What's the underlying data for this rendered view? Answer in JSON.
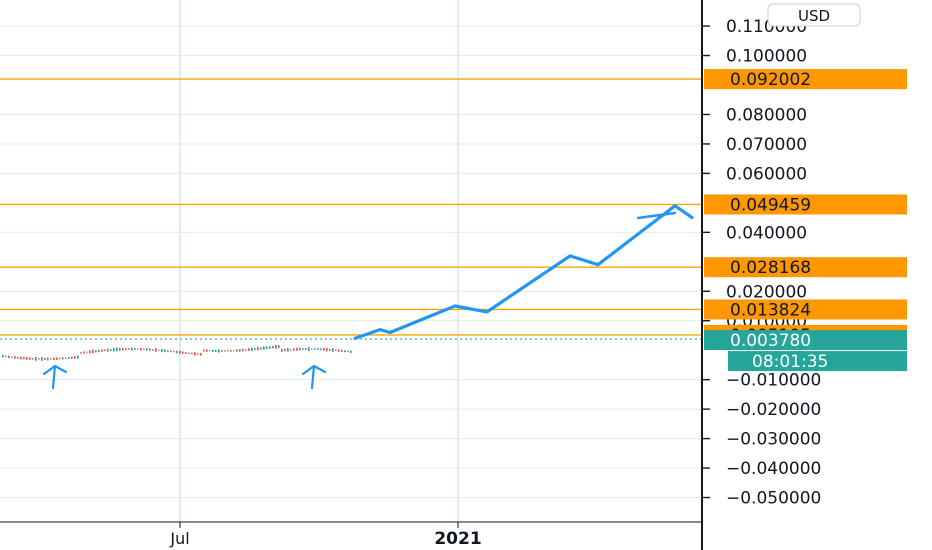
{
  "chart_data": {
    "type": "line",
    "currency": "USD",
    "y_axis": {
      "min": -0.05,
      "max": 0.11,
      "ticks": [
        {
          "value": 0.11,
          "label": "0.110000"
        },
        {
          "value": 0.1,
          "label": "0.100000"
        },
        {
          "value": 0.08,
          "label": "0.080000"
        },
        {
          "value": 0.07,
          "label": "0.070000"
        },
        {
          "value": 0.06,
          "label": "0.060000"
        },
        {
          "value": 0.04,
          "label": "0.040000"
        },
        {
          "value": 0.02,
          "label": "0.020000"
        },
        {
          "value": 0.01,
          "label": "0.010000"
        },
        {
          "value": -0.01,
          "label": "−0.010000"
        },
        {
          "value": -0.02,
          "label": "−0.020000"
        },
        {
          "value": -0.03,
          "label": "−0.030000"
        },
        {
          "value": -0.04,
          "label": "−0.040000"
        },
        {
          "value": -0.05,
          "label": "−0.050000"
        }
      ]
    },
    "x_axis": {
      "ticks": [
        {
          "label": "Jul",
          "bold": false
        },
        {
          "label": "2021",
          "bold": true
        }
      ]
    },
    "price_levels": [
      {
        "value": 0.092002,
        "label": "0.092002"
      },
      {
        "value": 0.049459,
        "label": "0.049459"
      },
      {
        "value": 0.028168,
        "label": "0.028168"
      },
      {
        "value": 0.013824,
        "label": "0.013824"
      },
      {
        "value": 0.005195,
        "label": "0.005195"
      }
    ],
    "current_price": {
      "value": 0.00378,
      "label": "0.003780",
      "countdown": "08:01:35"
    },
    "projection": [
      0.004,
      0.007,
      0.006,
      0.015,
      0.013,
      0.032,
      0.029,
      0.049,
      0.045
    ],
    "arrows": 3,
    "colors": {
      "level": "#f7a600",
      "level_tag": "#ff9800",
      "current_tag": "#26a69a",
      "projection": "#2196f3",
      "grid": "#e1ecf2",
      "candle_up": "#26a69a",
      "candle_down": "#ef5350"
    }
  }
}
